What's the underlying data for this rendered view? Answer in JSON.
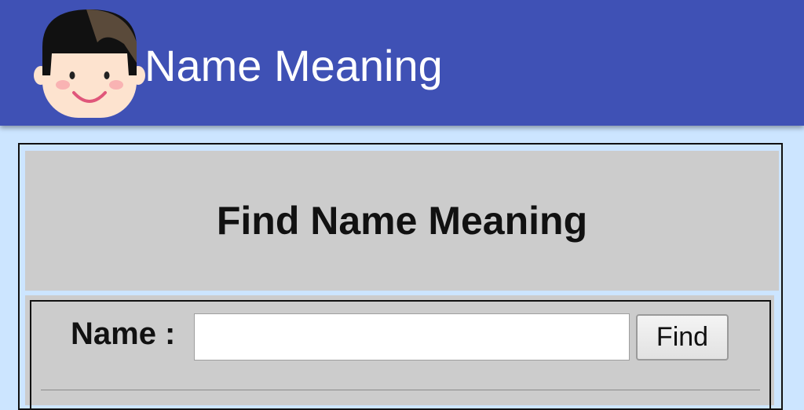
{
  "app": {
    "title": "Name Meaning"
  },
  "panel": {
    "heading": "Find Name Meaning"
  },
  "form": {
    "name_label": "Name :",
    "name_value": "",
    "name_placeholder": "",
    "find_label": "Find"
  },
  "icons": {
    "logo": "boy-face-icon"
  },
  "colors": {
    "appbar": "#3f51b5",
    "page_background": "#cce5ff",
    "panel_background": "#cccccc",
    "title_text": "#ffffff"
  }
}
